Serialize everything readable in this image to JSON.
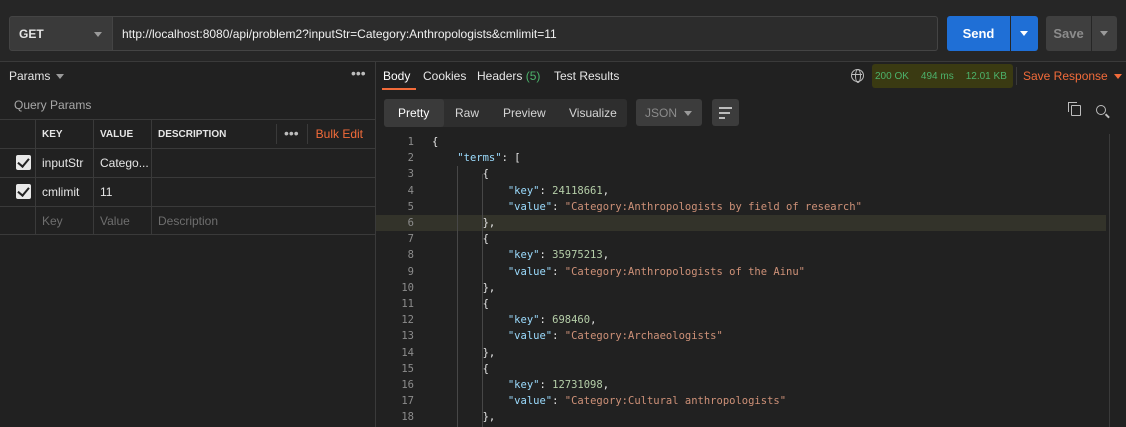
{
  "request": {
    "method": "GET",
    "url": "http://localhost:8080/api/problem2?inputStr=Category:Anthropologists&cmlimit=11",
    "send_label": "Send",
    "save_label": "Save"
  },
  "params_panel": {
    "title": "Params",
    "section_title": "Query Params",
    "columns": {
      "key": "KEY",
      "value": "VALUE",
      "description": "DESCRIPTION"
    },
    "bulk_edit_label": "Bulk Edit",
    "rows": [
      {
        "checked": true,
        "key": "inputStr",
        "value": "Catego...",
        "description": ""
      },
      {
        "checked": true,
        "key": "cmlimit",
        "value": "11",
        "description": ""
      }
    ],
    "placeholder": {
      "key": "Key",
      "value": "Value",
      "description": "Description"
    }
  },
  "response": {
    "tabs": [
      {
        "label": "Body",
        "active": true
      },
      {
        "label": "Cookies"
      },
      {
        "label": "Headers",
        "count": "(5)"
      },
      {
        "label": "Test Results"
      }
    ],
    "status": "200 OK",
    "time": "494 ms",
    "size": "12.01 KB",
    "save_response_label": "Save Response",
    "view_tabs": [
      "Pretty",
      "Raw",
      "Preview",
      "Visualize"
    ],
    "format": "JSON",
    "body_lines": [
      {
        "n": "1",
        "text": "{"
      },
      {
        "n": "2",
        "text": "    \"terms\": ["
      },
      {
        "n": "3",
        "text": "        {"
      },
      {
        "n": "4",
        "text": "            \"key\": 24118661,"
      },
      {
        "n": "5",
        "text": "            \"value\": \"Category:Anthropologists by field of research\""
      },
      {
        "n": "6",
        "text": "        },"
      },
      {
        "n": "7",
        "text": "        {"
      },
      {
        "n": "8",
        "text": "            \"key\": 35975213,"
      },
      {
        "n": "9",
        "text": "            \"value\": \"Category:Anthropologists of the Ainu\""
      },
      {
        "n": "10",
        "text": "        },"
      },
      {
        "n": "11",
        "text": "        {"
      },
      {
        "n": "12",
        "text": "            \"key\": 698460,"
      },
      {
        "n": "13",
        "text": "            \"value\": \"Category:Archaeologists\""
      },
      {
        "n": "14",
        "text": "        },"
      },
      {
        "n": "15",
        "text": "        {"
      },
      {
        "n": "16",
        "text": "            \"key\": 12731098,"
      },
      {
        "n": "17",
        "text": "            \"value\": \"Category:Cultural anthropologists\""
      },
      {
        "n": "18",
        "text": "        },"
      }
    ]
  },
  "colors": {
    "accent": "#f26b3a",
    "send": "#1f6fd6",
    "status_ok": "#4cb26b"
  }
}
